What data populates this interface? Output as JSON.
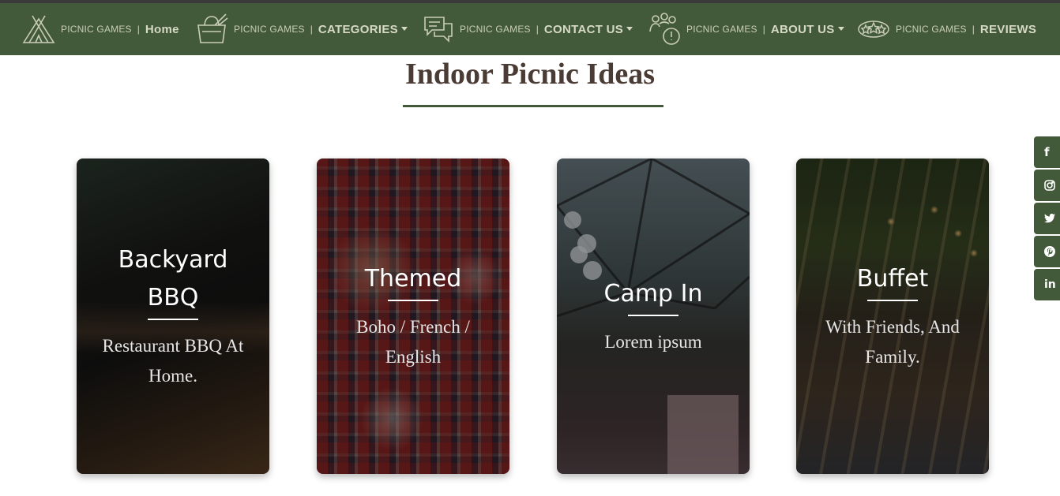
{
  "nav": {
    "brand": "PICNIC GAMES",
    "separator": "|",
    "items": [
      {
        "label": "Home",
        "icon": "teepee-icon",
        "dropdown": false
      },
      {
        "label": "CATEGORIES",
        "icon": "basket-icon",
        "dropdown": true
      },
      {
        "label": "CONTACT US",
        "icon": "chat-bubbles-icon",
        "dropdown": true
      },
      {
        "label": "ABOUT US",
        "icon": "team-icon",
        "dropdown": true
      },
      {
        "label": "REVIEWS",
        "icon": "stars-icon",
        "dropdown": false
      }
    ]
  },
  "section": {
    "title": "Indoor Picnic Ideas"
  },
  "cards": [
    {
      "title": "Backyard BBQ",
      "subtitle": "Restaurant BBQ At Home."
    },
    {
      "title": "Themed",
      "subtitle": "Boho / French / English"
    },
    {
      "title": "Camp In",
      "subtitle": "Lorem ipsum"
    },
    {
      "title": "Buffet",
      "subtitle": "With Friends, And Family."
    }
  ],
  "social": [
    {
      "name": "facebook-icon",
      "glyph": "f"
    },
    {
      "name": "instagram-icon",
      "glyph": ""
    },
    {
      "name": "twitter-icon",
      "glyph": ""
    },
    {
      "name": "pinterest-icon",
      "glyph": ""
    },
    {
      "name": "linkedin-icon",
      "glyph": "in"
    }
  ],
  "colors": {
    "nav_bg": "#435a3a",
    "title": "#4a3b35",
    "accent": "#435a3a"
  }
}
